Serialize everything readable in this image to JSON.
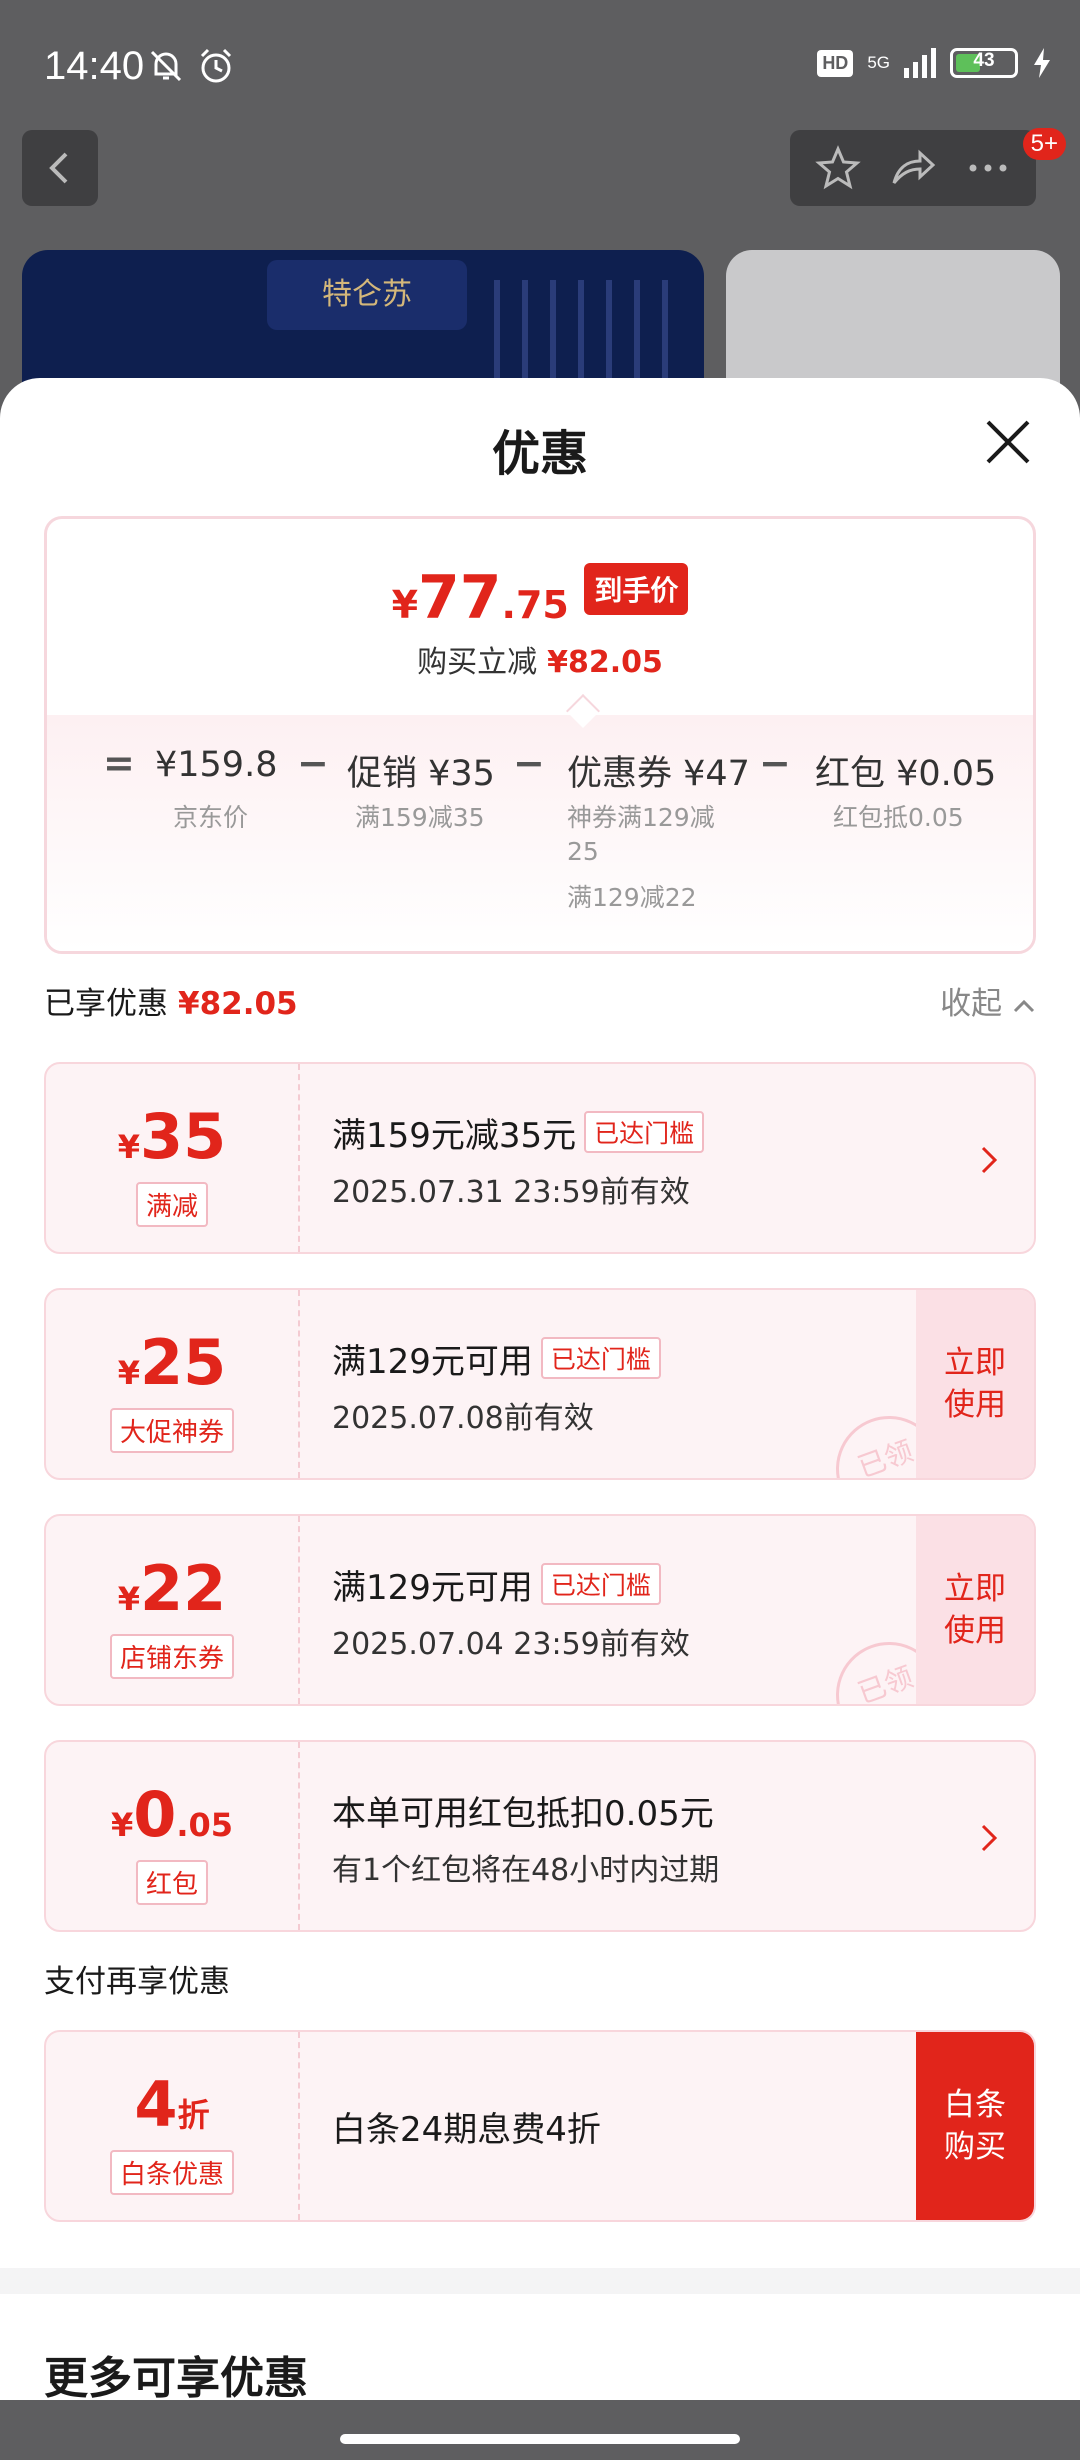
{
  "status_bar": {
    "time": "14:40",
    "hd": "HD",
    "network": "5G",
    "battery": "43",
    "battery_level": 0.43
  },
  "nav": {
    "cart_badge": "5+"
  },
  "background": {
    "brand_logo": "特仑苏"
  },
  "sheet": {
    "title": "优惠"
  },
  "summary": {
    "currency": "¥",
    "final_int": "77",
    "final_dec": ".75",
    "final_tag": "到手价",
    "reduce_label": "购买立减",
    "reduce_amount": "¥82.05",
    "equals": "=",
    "minus": "−",
    "jd_price": "¥159.8",
    "jd_price_label": "京东价",
    "promo": "促销 ¥35",
    "promo_desc": "满159减35",
    "coupon": "优惠券 ¥47",
    "coupon_desc_1a": "神券满129减",
    "coupon_desc_1b": "25",
    "coupon_desc_2": "满129减22",
    "redpack": "红包 ¥0.05",
    "redpack_desc": "红包抵0.05"
  },
  "enjoyed": {
    "label": "已享优惠",
    "amount": "¥82.05",
    "collapse": "收起"
  },
  "coupons": [
    {
      "currency": "¥",
      "amount": "35",
      "decimal": "",
      "tag": "满减",
      "title": "满159元减35元",
      "badge": "已达门槛",
      "desc": "2025.07.31 23:59前有效"
    },
    {
      "currency": "¥",
      "amount": "25",
      "decimal": "",
      "tag": "大促神券",
      "title": "满129元可用",
      "badge": "已达门槛",
      "desc": "2025.07.08前有效",
      "action": [
        "立即",
        "使用"
      ],
      "stamp": "已领"
    },
    {
      "currency": "¥",
      "amount": "22",
      "decimal": "",
      "tag": "店铺东券",
      "title": "满129元可用",
      "badge": "已达门槛",
      "desc": "2025.07.04 23:59前有效",
      "action": [
        "立即",
        "使用"
      ],
      "stamp": "已领"
    },
    {
      "currency": "¥",
      "amount": "0",
      "decimal": ".05",
      "tag": "红包",
      "title": "本单可用红包抵扣0.05元",
      "desc": "有1个红包将在48小时内过期"
    }
  ],
  "pay": {
    "label": "支付再享优惠",
    "amount": "4",
    "unit": "折",
    "tag": "白条优惠",
    "title": "白条24期息费4折",
    "action": [
      "白条",
      "购买"
    ]
  },
  "more": {
    "title": "更多可享优惠"
  },
  "colors": {
    "accent": "#e1251b",
    "coupon_bg": "#fdf3f5",
    "border": "#f8d6dc"
  }
}
